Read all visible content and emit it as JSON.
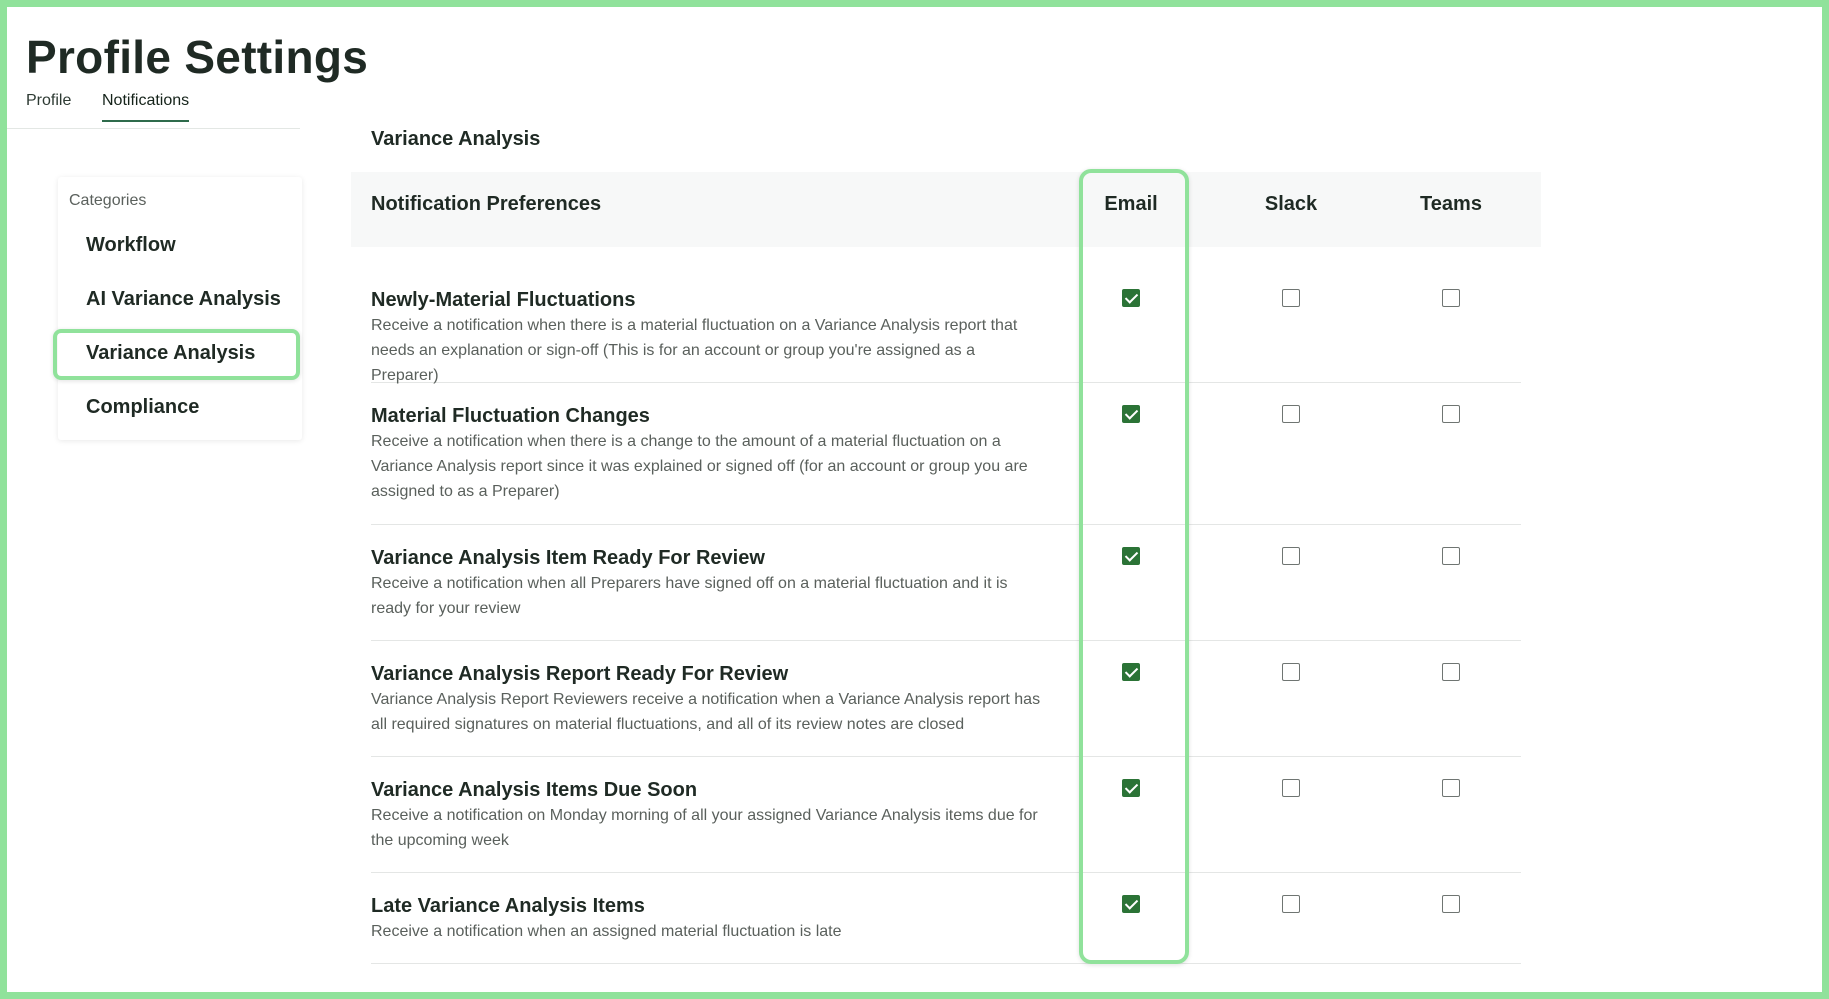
{
  "page": {
    "title": "Profile Settings"
  },
  "tabs": [
    {
      "label": "Profile",
      "active": false
    },
    {
      "label": "Notifications",
      "active": true
    }
  ],
  "sidebar": {
    "heading": "Categories",
    "items": [
      {
        "label": "Workflow",
        "selected": false
      },
      {
        "label": "AI Variance Analysis",
        "selected": false
      },
      {
        "label": "Variance Analysis",
        "selected": true
      },
      {
        "label": "Compliance",
        "selected": false
      }
    ]
  },
  "section": {
    "title": "Variance Analysis"
  },
  "table": {
    "headers": {
      "preferences": "Notification Preferences",
      "email": "Email",
      "slack": "Slack",
      "teams": "Teams"
    },
    "rows": [
      {
        "title": "Newly-Material Fluctuations",
        "description": "Receive a notification when there is a material fluctuation on a Variance Analysis report that needs an explanation or sign-off (This is for an account or group you're assigned as a Preparer)",
        "email": true,
        "slack": false,
        "teams": false
      },
      {
        "title": "Material Fluctuation Changes",
        "description": "Receive a notification when there is a change to the amount of a material fluctuation on a Variance Analysis report since it was explained or signed off (for an account or group you are assigned to as a Preparer)",
        "email": true,
        "slack": false,
        "teams": false
      },
      {
        "title": "Variance Analysis Item Ready For Review",
        "description": "Receive a notification when all Preparers have signed off on a material fluctuation and it is ready for your review",
        "email": true,
        "slack": false,
        "teams": false
      },
      {
        "title": "Variance Analysis Report Ready For Review",
        "description": "Variance Analysis Report Reviewers receive a notification when a Variance Analysis report has all required signatures on material fluctuations, and all of its review notes are closed",
        "email": true,
        "slack": false,
        "teams": false
      },
      {
        "title": "Variance Analysis Items Due Soon",
        "description": "Receive a notification on Monday morning of all your assigned Variance Analysis items due for the upcoming week",
        "email": true,
        "slack": false,
        "teams": false
      },
      {
        "title": "Late Variance Analysis Items",
        "description": "Receive a notification when an assigned material fluctuation is late",
        "email": true,
        "slack": false,
        "teams": false
      }
    ]
  },
  "colors": {
    "accent_checkbox": "#2b7336",
    "highlight": "#90e29b",
    "header_band": "#f7f8f8",
    "active_tab_underline": "#2e6b4b"
  }
}
